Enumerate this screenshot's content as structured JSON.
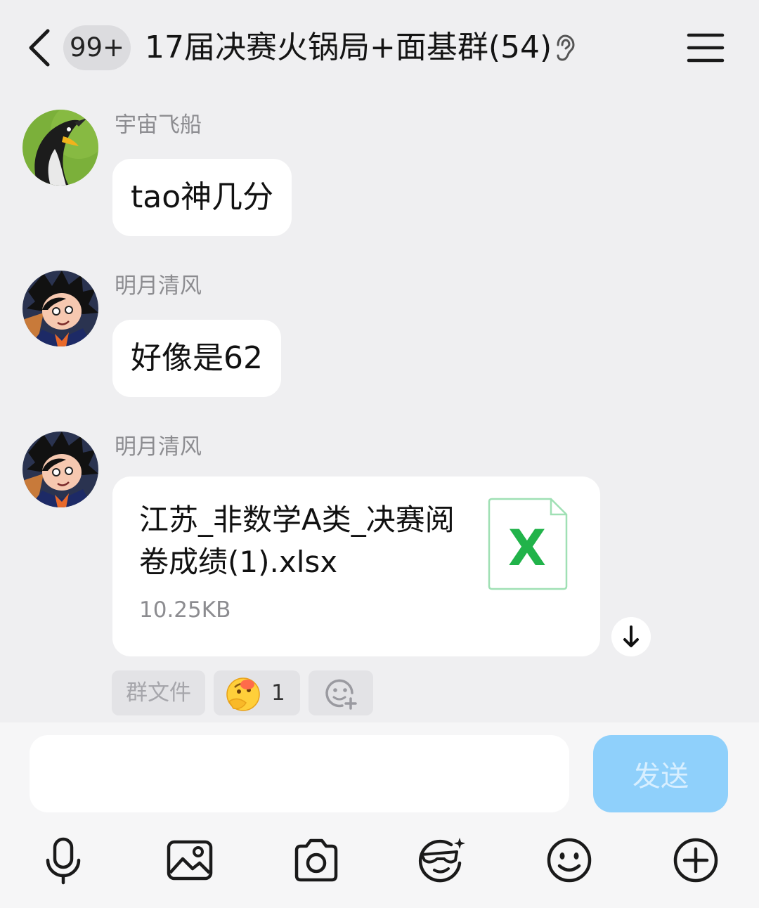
{
  "header": {
    "back_icon": "chevron-left-icon",
    "unread_badge": "99+",
    "title": "17届决赛火锅局+面基群(54)",
    "earpiece_icon": "ear-icon",
    "menu_icon": "hamburger-menu-icon"
  },
  "messages": [
    {
      "sender": "宇宙飞船",
      "text": "tao神几分",
      "avatar": "penguin-avatar"
    },
    {
      "sender": "明月清风",
      "text": "好像是62",
      "avatar": "anime-boy-avatar"
    },
    {
      "sender": "明月清风",
      "avatar": "anime-boy-avatar",
      "file": {
        "name": "江苏_非数学A类_决赛阅卷成绩(1).xlsx",
        "size": "10.25KB",
        "icon": "excel-file-icon",
        "file_icon_letter": "X"
      },
      "chips": {
        "group_files": "群文件",
        "reaction_emoji": "thinking-emoji-icon",
        "reaction_count": "1",
        "add_reaction_icon": "add-reaction-icon"
      },
      "download_icon": "download-arrow-icon"
    }
  ],
  "composer": {
    "input_value": "",
    "send_label": "发送"
  },
  "toolbar": [
    {
      "icon": "microphone-icon"
    },
    {
      "icon": "image-icon"
    },
    {
      "icon": "camera-icon"
    },
    {
      "icon": "sticker-icon"
    },
    {
      "icon": "emoji-icon"
    },
    {
      "icon": "plus-circle-icon"
    }
  ],
  "colors": {
    "background": "#efeff1",
    "bubble": "#ffffff",
    "send_button": "#8fd0fb",
    "excel_green": "#21b34a"
  }
}
